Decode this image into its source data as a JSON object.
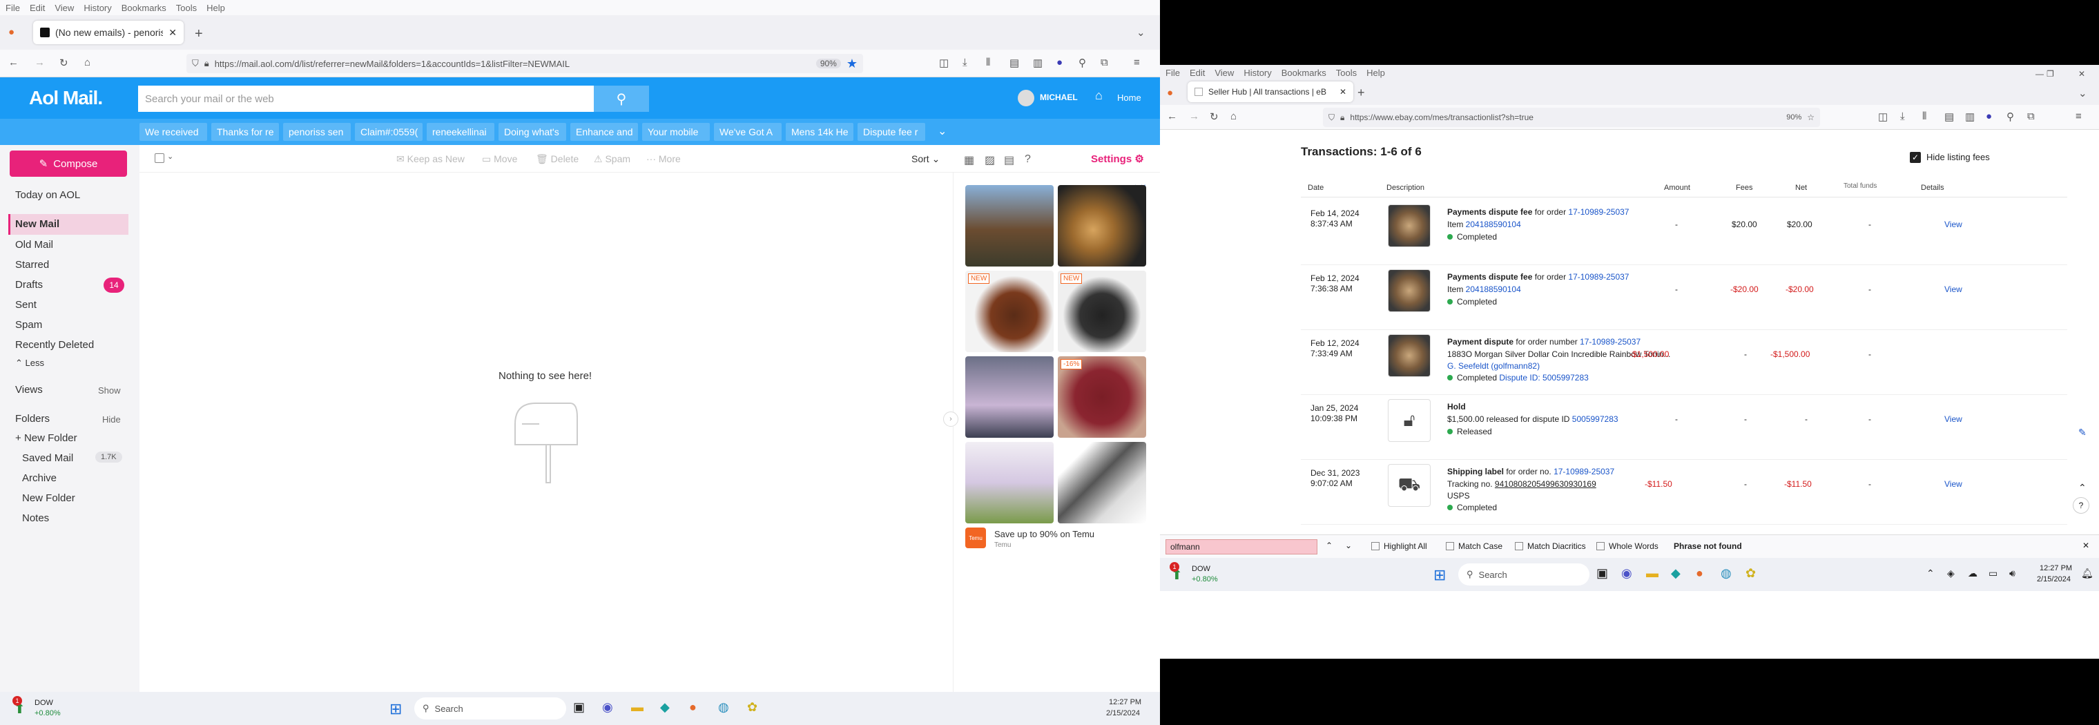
{
  "left_browser": {
    "menu": [
      "File",
      "Edit",
      "View",
      "History",
      "Bookmarks",
      "Tools",
      "Help"
    ],
    "tab_title": "(No new emails) - penoriss@a",
    "url": "https://mail.aol.com/d/list/referrer=newMail&folders=1&accountIds=1&listFilter=NEWMAIL",
    "zoom": "90%"
  },
  "aol": {
    "logo": "Aol Mail.",
    "search_placeholder": "Search your mail or the web",
    "user": "MICHAEL",
    "home": "Home",
    "chips": [
      "We received",
      "Thanks for re",
      "penoriss sen",
      "Claim#:0559(",
      "reneekellinai",
      "Doing what's",
      "Enhance and",
      "Your mobile",
      "We've Got A",
      "Mens 14k He",
      "Dispute fee r"
    ],
    "compose": "Compose",
    "today": "Today on AOL",
    "folders": [
      {
        "label": "New Mail"
      },
      {
        "label": "Old Mail"
      },
      {
        "label": "Starred"
      },
      {
        "label": "Drafts",
        "count": "14"
      },
      {
        "label": "Sent"
      },
      {
        "label": "Spam"
      },
      {
        "label": "Recently Deleted"
      }
    ],
    "less": "Less",
    "views": "Views",
    "show": "Show",
    "folders_label": "Folders",
    "hide": "Hide",
    "new_folder": "New Folder",
    "subfolders": [
      {
        "label": "Saved Mail",
        "count": "1.7K"
      },
      {
        "label": "Archive"
      },
      {
        "label": "New Folder"
      },
      {
        "label": "Notes"
      }
    ],
    "toolbar": {
      "keep_as_new": "Keep as New",
      "move": "Move",
      "delete": "Delete",
      "spam": "Spam",
      "more": "More",
      "sort": "Sort",
      "settings": "Settings"
    },
    "empty": "Nothing to see here!",
    "ad_labels": [
      "NEW",
      "NEW",
      "-16%"
    ],
    "ad_footer": "Save up to 90% on Temu",
    "ad_brand": "Temu",
    "temu_logo": "Temu"
  },
  "taskbar_left": {
    "dow": "DOW",
    "dow_change": "+0.80%",
    "search": "Search",
    "time": "12:27 PM",
    "date": "2/15/2024",
    "notif": "1"
  },
  "right_browser": {
    "menu": [
      "File",
      "Edit",
      "View",
      "History",
      "Bookmarks",
      "Tools",
      "Help"
    ],
    "tab_title": "Seller Hub | All transactions | eB",
    "url": "https://www.ebay.com/mes/transactionlist?sh=true",
    "zoom": "90%"
  },
  "ebay": {
    "heading": "Transactions: 1-6 of 6",
    "hide_fees": "Hide listing fees",
    "headers": {
      "date": "Date",
      "description": "Description",
      "amount": "Amount",
      "fees": "Fees",
      "net": "Net",
      "total": "Total funds",
      "details": "Details"
    },
    "rows": [
      {
        "date": "Feb 14, 2024",
        "time": "8:37:43 AM",
        "title": "Payments dispute fee",
        "mid": " for order ",
        "order": "17-10989-25037",
        "line2a": "Item ",
        "line2b": "204188590104",
        "line3": "",
        "status": "Completed",
        "status_extra": "",
        "amount": "-",
        "fees": "$20.00",
        "net": "$20.00",
        "total": "-",
        "details": "View"
      },
      {
        "date": "Feb 12, 2024",
        "time": "7:36:38 AM",
        "title": "Payments dispute fee",
        "mid": " for order ",
        "order": "17-10989-25037",
        "line2a": "Item ",
        "line2b": "204188590104",
        "line3": "",
        "status": "Completed",
        "status_extra": "",
        "amount": "-",
        "fees": "-$20.00",
        "net": "-$20.00",
        "total": "-",
        "details": "View"
      },
      {
        "date": "Feb 12, 2024",
        "time": "7:33:49 AM",
        "title": "Payment dispute",
        "mid": " for order number ",
        "order": "17-10989-25037",
        "line2a": "1883O Morgan Silver Dollar Coin Incredible Rainbow Tonin...",
        "line2b": "",
        "line3": "G. Seefeldt (golfmann82)",
        "status": "Completed",
        "status_extra": " Dispute ID: 5005997283",
        "amount": "-$1,500.00",
        "fees": "-",
        "net": "-$1,500.00",
        "total": "-",
        "details": ""
      },
      {
        "date": "Jan 25, 2024",
        "time": "10:09:38 PM",
        "title": "Hold",
        "mid": "",
        "order": "",
        "line2a": "$1,500.00 released for dispute ID ",
        "line2b": "5005997283",
        "line3": "",
        "status": "Released",
        "status_extra": "",
        "amount": "-",
        "fees": "-",
        "net": "-",
        "total": "-",
        "details": "View"
      },
      {
        "date": "Dec 31, 2023",
        "time": "9:07:02 AM",
        "title": "Shipping label",
        "mid": " for order no. ",
        "order": "17-10989-25037",
        "line2a": "Tracking no. ",
        "line2b": "9410808205499630930169",
        "line3": "USPS",
        "status": "Completed",
        "status_extra": "",
        "amount": "-$11.50",
        "fees": "-",
        "net": "-$11.50",
        "total": "-",
        "details": "View"
      }
    ]
  },
  "findbar": {
    "query": "olfmann",
    "highlight": "Highlight All",
    "match_case": "Match Case",
    "diacritics": "Match Diacritics",
    "whole": "Whole Words",
    "status": "Phrase not found"
  },
  "taskbar_right": {
    "dow": "DOW",
    "dow_change": "+0.80%",
    "search": "Search",
    "time": "12:27 PM",
    "date": "2/15/2024",
    "notif": "1"
  }
}
